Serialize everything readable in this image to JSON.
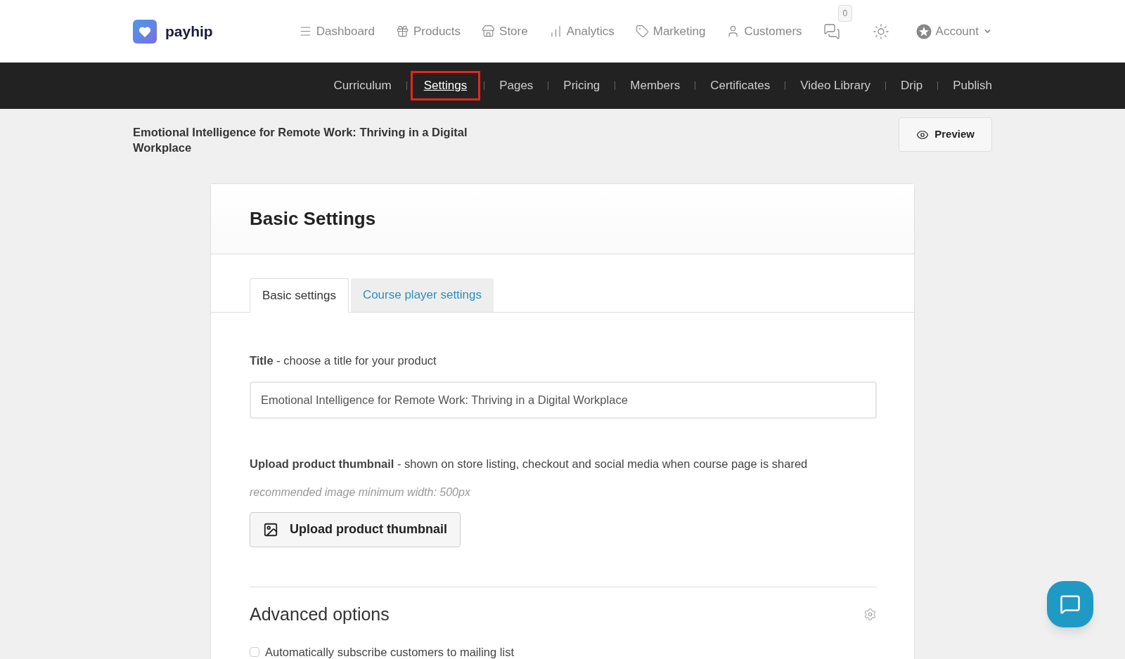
{
  "brand": {
    "name": "payhip"
  },
  "nav": [
    {
      "label": "Dashboard"
    },
    {
      "label": "Products"
    },
    {
      "label": "Store"
    },
    {
      "label": "Analytics"
    },
    {
      "label": "Marketing"
    },
    {
      "label": "Customers"
    }
  ],
  "messages_badge": "0",
  "account": {
    "label": "Account"
  },
  "subnav": [
    {
      "label": "Curriculum",
      "selected": false
    },
    {
      "label": "Settings",
      "selected": true
    },
    {
      "label": "Pages",
      "selected": false
    },
    {
      "label": "Pricing",
      "selected": false
    },
    {
      "label": "Members",
      "selected": false
    },
    {
      "label": "Certificates",
      "selected": false
    },
    {
      "label": "Video Library",
      "selected": false
    },
    {
      "label": "Drip",
      "selected": false
    },
    {
      "label": "Publish",
      "selected": false
    }
  ],
  "product_title": "Emotional Intelligence for Remote Work: Thriving in a Digital Workplace",
  "preview_button": "Preview",
  "card": {
    "heading": "Basic Settings",
    "tabs": [
      {
        "label": "Basic settings",
        "selected": true
      },
      {
        "label": "Course player settings",
        "selected": false
      }
    ],
    "title_field": {
      "label": "**Title** - choose a title for your product",
      "value": "Emotional Intelligence for Remote Work: Thriving in a Digital Workplace"
    },
    "thumbnail": {
      "label": "**Upload product thumbnail** - shown on store listing, checkout and social media when course page is shared",
      "hint": "recommended image minimum width: 500px",
      "button": "Upload product thumbnail"
    },
    "advanced": {
      "heading": "Advanced options",
      "options": [
        {
          "label": "Automatically subscribe customers to mailing list",
          "checked": false
        }
      ]
    }
  }
}
